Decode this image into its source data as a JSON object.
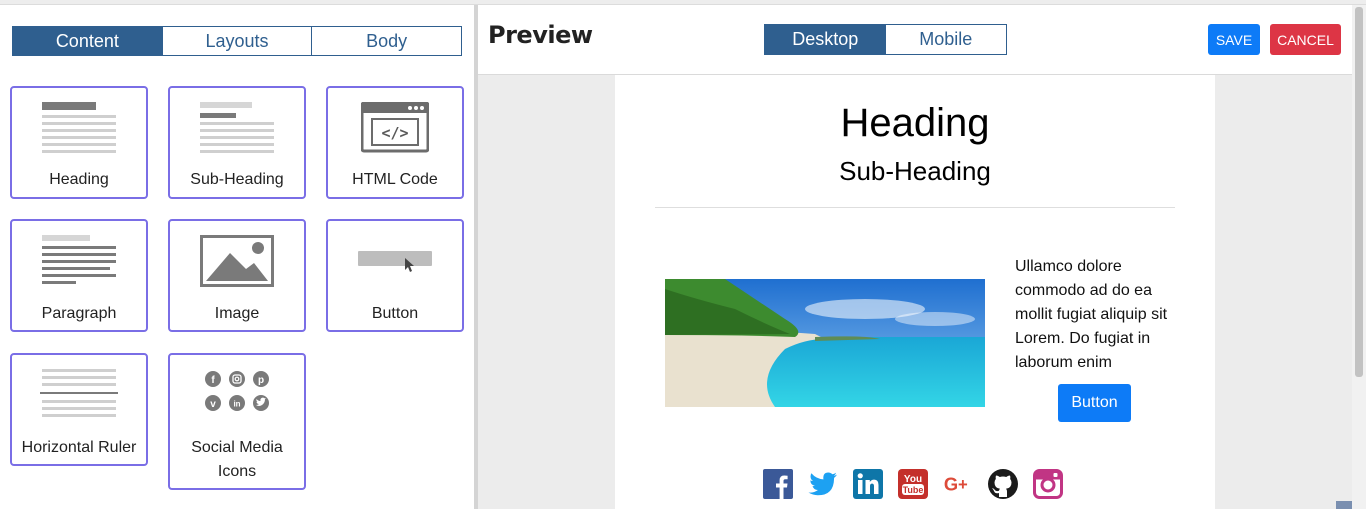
{
  "left_panel": {
    "tabs": [
      "Content",
      "Layouts",
      "Body"
    ],
    "blocks": [
      {
        "label": "Heading",
        "icon": "heading-icon"
      },
      {
        "label": "Sub-Heading",
        "icon": "sub-heading-icon"
      },
      {
        "label": "HTML Code",
        "icon": "html-code-icon"
      },
      {
        "label": "Paragraph",
        "icon": "paragraph-icon"
      },
      {
        "label": "Image",
        "icon": "image-icon"
      },
      {
        "label": "Button",
        "icon": "button-icon"
      },
      {
        "label": "Horizontal Ruler",
        "icon": "horizontal-ruler-icon"
      },
      {
        "label": "Social Media Icons",
        "icon": "social-media-icon"
      }
    ]
  },
  "preview": {
    "title": "Preview",
    "device_tabs": [
      "Desktop",
      "Mobile"
    ],
    "save_label": "SAVE",
    "cancel_label": "CANCEL",
    "heading": "Heading",
    "subheading": "Sub-Heading",
    "paragraph": "Ullamco dolore commodo ad do ea mollit fugiat aliquip sit Lorem. Do fugiat in laborum enim",
    "button_label": "Button",
    "social_icons": [
      "facebook-icon",
      "twitter-icon",
      "linkedin-icon",
      "youtube-icon",
      "google-plus-icon",
      "github-icon",
      "instagram-icon"
    ]
  },
  "colors": {
    "accent": "#2f5f8f",
    "block_border": "#7a6ee6",
    "save": "#0d7bf7",
    "cancel": "#dd3545"
  }
}
